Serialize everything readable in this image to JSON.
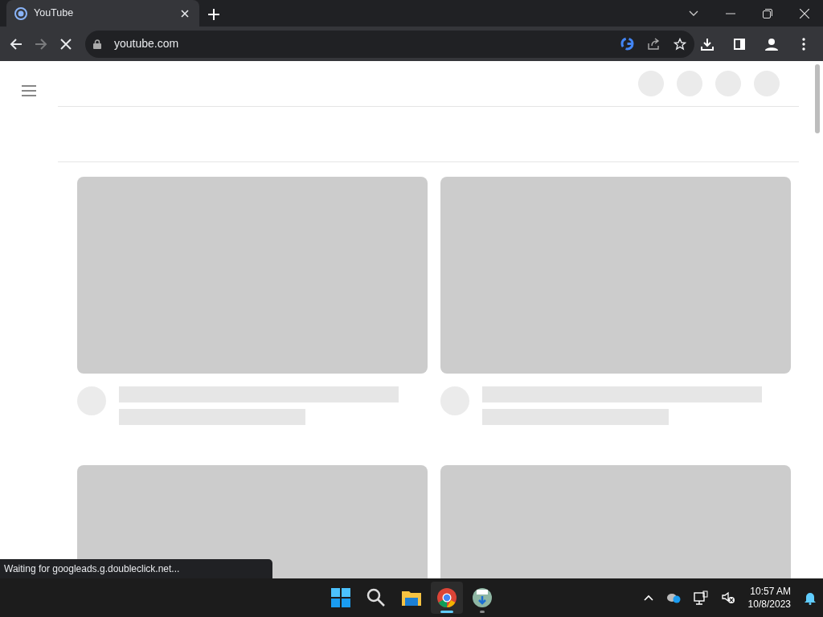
{
  "browser": {
    "tabs": [
      {
        "title": "YouTube",
        "selected": true
      }
    ],
    "loading": true,
    "address": "youtube.com"
  },
  "status_bubble": "Waiting for googleads.g.doubleclick.net...",
  "taskbar": {
    "apps": [
      {
        "kind": "start",
        "running": false,
        "selected": false
      },
      {
        "kind": "search",
        "running": false,
        "selected": false
      },
      {
        "kind": "folder",
        "running": false,
        "selected": false
      },
      {
        "kind": "browser",
        "running": true,
        "selected": true
      },
      {
        "kind": "installer",
        "running": true,
        "selected": false
      }
    ],
    "time": "10:57 AM",
    "date": "10/8/2023"
  }
}
